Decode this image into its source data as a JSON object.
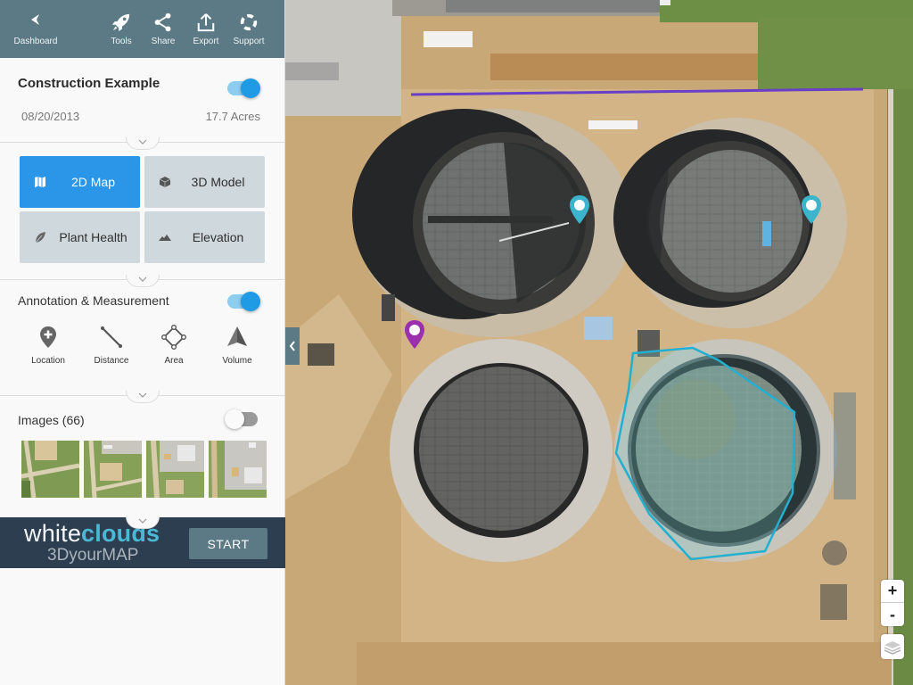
{
  "topbar": {
    "items": [
      {
        "id": "dashboard",
        "label": "Dashboard",
        "icon": "chevron-left-icon"
      },
      {
        "id": "tools",
        "label": "Tools",
        "icon": "rocket-icon"
      },
      {
        "id": "share",
        "label": "Share",
        "icon": "share-icon"
      },
      {
        "id": "export",
        "label": "Export",
        "icon": "export-icon"
      },
      {
        "id": "support",
        "label": "Support",
        "icon": "lifebuoy-icon"
      }
    ]
  },
  "project": {
    "title": "Construction Example",
    "date": "08/20/2013",
    "area": "17.7 Acres",
    "visible": true
  },
  "views": [
    {
      "label": "2D Map",
      "icon": "map-icon",
      "active": true
    },
    {
      "label": "3D Model",
      "icon": "cube-icon",
      "active": false
    },
    {
      "label": "Plant Health",
      "icon": "leaf-icon",
      "active": false
    },
    {
      "label": "Elevation",
      "icon": "mountain-icon",
      "active": false
    }
  ],
  "annotation": {
    "title": "Annotation & Measurement",
    "enabled": true,
    "tools": [
      {
        "label": "Location",
        "icon": "location-plus-icon"
      },
      {
        "label": "Distance",
        "icon": "distance-line-icon"
      },
      {
        "label": "Area",
        "icon": "area-polygon-icon"
      },
      {
        "label": "Volume",
        "icon": "volume-pyramid-icon"
      }
    ]
  },
  "images": {
    "title": "Images (66)",
    "count": 66,
    "enabled": false
  },
  "promo": {
    "brand_white": "white",
    "brand_clouds": "clouds",
    "tagline": "3DyourMAP",
    "start_label": "START"
  },
  "map": {
    "zoom_in_label": "+",
    "zoom_out_label": "-",
    "collapse_label": "‹",
    "annotations": [
      {
        "type": "marker",
        "color": "#3bb4cc"
      },
      {
        "type": "marker",
        "color": "#3bb4cc"
      },
      {
        "type": "marker",
        "color": "#9b2fae"
      },
      {
        "type": "line",
        "color": "#6a3fc8"
      },
      {
        "type": "polygon",
        "color": "#23b0d0"
      }
    ]
  },
  "colors": {
    "topbar": "#5b7a86",
    "accent": "#2b96e8",
    "promo_bg": "#2c3e4f",
    "brand_cyan": "#4bb8d6"
  }
}
